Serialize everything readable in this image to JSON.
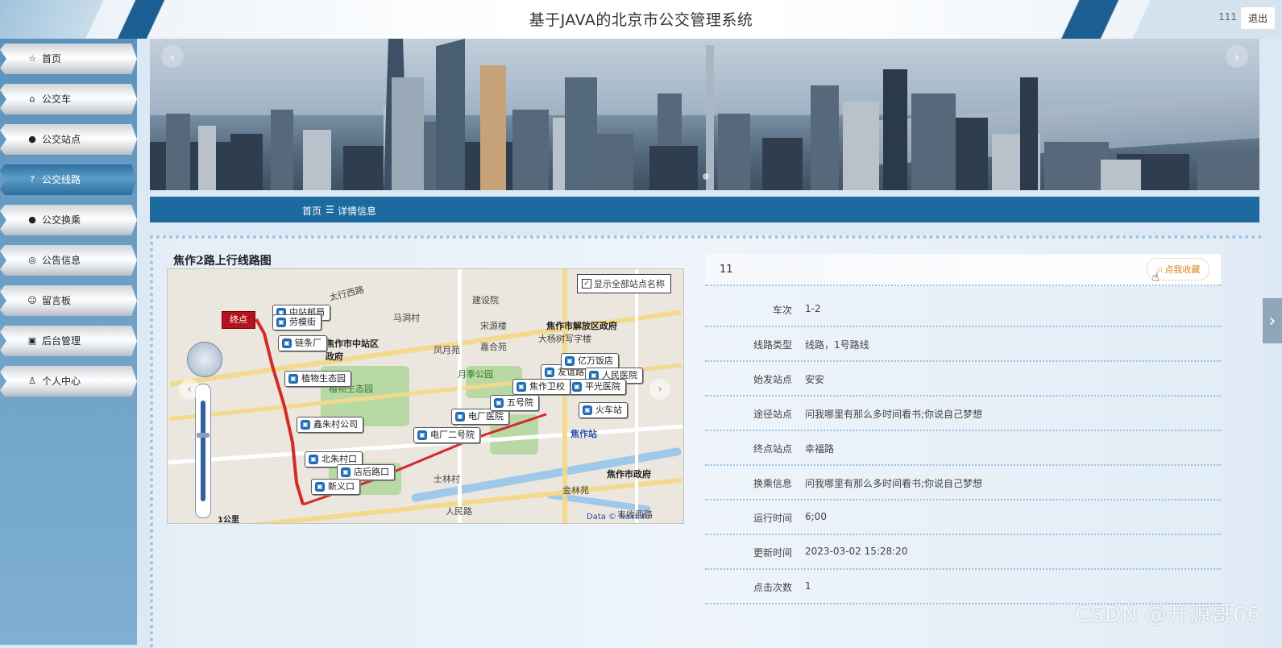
{
  "header": {
    "title": "基于JAVA的北京市公交管理系统",
    "user": "111",
    "logout_label": "退出"
  },
  "sidebar": {
    "items": [
      {
        "icon": "star-icon",
        "glyph": "☆",
        "label": "首页"
      },
      {
        "icon": "bag-icon",
        "glyph": "⌂",
        "label": "公交车"
      },
      {
        "icon": "alert-icon",
        "glyph": "●",
        "label": "公交站点"
      },
      {
        "icon": "help-icon",
        "glyph": "?",
        "label": "公交线路"
      },
      {
        "icon": "info-icon",
        "glyph": "●",
        "label": "公交换乘"
      },
      {
        "icon": "globe-icon",
        "glyph": "◎",
        "label": "公告信息"
      },
      {
        "icon": "smile-icon",
        "glyph": "☺",
        "label": "留言板"
      },
      {
        "icon": "briefcase-icon",
        "glyph": "▣",
        "label": "后台管理"
      },
      {
        "icon": "user-icon",
        "glyph": "♙",
        "label": "个人中心"
      }
    ],
    "active_index": 3
  },
  "breadcrumb": {
    "home": "首页",
    "separator": "☰",
    "current": "详情信息"
  },
  "map": {
    "title": "焦作2路上行线路图",
    "show_all_label": "显示全部站点名称",
    "end_label": "终点",
    "stops": [
      "中站邮局",
      "劳模街",
      "链条厂",
      "植物生态园",
      "鑫朱村公司",
      "北朱村口",
      "店后路口",
      "新义口",
      "电厂二号院",
      "电厂医院",
      "友谊路口",
      "亿万饭店",
      "人民医院",
      "平光医院",
      "火车站",
      "五号院",
      "焦作卫校"
    ],
    "places": [
      "太行西路",
      "马洞村",
      "建设院",
      "宋源楼",
      "焦作市解放区政府",
      "大杨树写字楼",
      "焦作市中站区政府",
      "凤月苑",
      "嘉合苑",
      "月季公园",
      "植物生态园",
      "焦作站",
      "焦作市政府",
      "金林苑",
      "士林村",
      "人民路",
      "丰收西路"
    ],
    "scale_label": "1公里",
    "copyright": "Data © NavInfo"
  },
  "details": {
    "id_value": "11",
    "favorite_label": "点我收藏",
    "rows": [
      {
        "key": "车次",
        "value": "1-2"
      },
      {
        "key": "线路类型",
        "value": "线路，1号路线"
      },
      {
        "key": "始发站点",
        "value": "安安"
      },
      {
        "key": "途径站点",
        "value": "问我哪里有那么多时间看书;你说自己梦想"
      },
      {
        "key": "终点站点",
        "value": "幸福路"
      },
      {
        "key": "换乘信息",
        "value": "问我哪里有那么多时间看书;你说自己梦想"
      },
      {
        "key": "运行时间",
        "value": "6;00"
      },
      {
        "key": "更新时间",
        "value": "2023-03-02 15:28:20"
      },
      {
        "key": "点击次数",
        "value": "1"
      }
    ]
  },
  "watermark": "CSDN @开源哥66",
  "colors": {
    "primary": "#1c6aa0",
    "accent_fav": "#e08412",
    "route_red": "#d42a2a"
  }
}
